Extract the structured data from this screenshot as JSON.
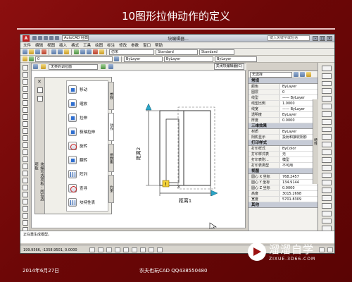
{
  "slide": {
    "title": "10图形拉伸动作的定义",
    "date": "2014年6月27日",
    "author": "农夫也玩CAD  QQ438550480"
  },
  "watermark": {
    "name": "溜溜自学",
    "url": "ZIXUE.3D66.COM"
  },
  "app": {
    "doc_title": "块编辑器...",
    "search_placeholder": "键入关键字或短语",
    "workspace": "AutoCAD 经典",
    "menus": [
      "文件",
      "编辑",
      "视图",
      "插入",
      "格式",
      "工具",
      "绘图",
      "标注",
      "修改",
      "参数",
      "窗口",
      "帮助"
    ],
    "layer_combo": "0",
    "style_combo": "仿宋",
    "standard_combo": "Standard",
    "standard_combo2": "Standard",
    "color_combo": "ByLayer",
    "linetype_combo": "ByLayer",
    "lineweight_combo": "ByLayer",
    "block_name": "无类的调拉面",
    "block_close": "关闭块编辑器(C)"
  },
  "palette": {
    "items": [
      {
        "label": "移动",
        "icon": "move-icon"
      },
      {
        "label": "缩放",
        "icon": "scale-icon"
      },
      {
        "label": "拉伸",
        "icon": "stretch-icon"
      },
      {
        "label": "极轴拉伸",
        "icon": "polar-stretch-icon"
      },
      {
        "label": "旋转",
        "icon": "rotate-icon"
      },
      {
        "label": "翻转",
        "icon": "flip-icon"
      },
      {
        "label": "阵列",
        "icon": "array-icon"
      },
      {
        "label": "查寻",
        "icon": "lookup-icon"
      },
      {
        "label": "块特性表",
        "icon": "block-table-icon"
      }
    ],
    "tabs": [
      "参数",
      "动作",
      "参数集",
      "约束"
    ],
    "side_label": "块编写选项板 - 所有选项板"
  },
  "drawing": {
    "dim_horizontal": "距离1",
    "dim_vertical": "距离2",
    "badge": "!"
  },
  "properties": {
    "selection": "无选择",
    "title": "特性",
    "sections": [
      {
        "name": "常规",
        "rows": [
          {
            "k": "颜色",
            "v": "ByLayer"
          },
          {
            "k": "图层",
            "v": "0"
          },
          {
            "k": "线型",
            "v": "—— ByLayer"
          },
          {
            "k": "线型比例",
            "v": "1.0000"
          },
          {
            "k": "线宽",
            "v": "—— ByLayer"
          },
          {
            "k": "透明度",
            "v": "ByLayer"
          },
          {
            "k": "厚度",
            "v": "0.0000"
          }
        ]
      },
      {
        "name": "三维效果",
        "rows": [
          {
            "k": "材质",
            "v": "ByLayer"
          },
          {
            "k": "阴影显示",
            "v": "投射和接收阴影"
          }
        ]
      },
      {
        "name": "打印样式",
        "rows": [
          {
            "k": "打印样式",
            "v": "ByColor"
          },
          {
            "k": "打印样式表",
            "v": "无"
          },
          {
            "k": "打印表附...",
            "v": "模型"
          },
          {
            "k": "打印表类型",
            "v": "不可用"
          }
        ]
      },
      {
        "name": "视图",
        "rows": [
          {
            "k": "圆心 X 坐标",
            "v": "768.2457"
          },
          {
            "k": "圆心 Y 坐标",
            "v": "134.9144"
          },
          {
            "k": "圆心 Z 坐标",
            "v": "0.0000"
          },
          {
            "k": "高度",
            "v": "3015.2698"
          },
          {
            "k": "宽度",
            "v": "5701.8309"
          }
        ]
      },
      {
        "name": "其他",
        "rows": []
      }
    ]
  },
  "command": {
    "text": "正在重生成模型。"
  },
  "status": {
    "coords": "199.9566, -1358.9501, 0.0000"
  }
}
